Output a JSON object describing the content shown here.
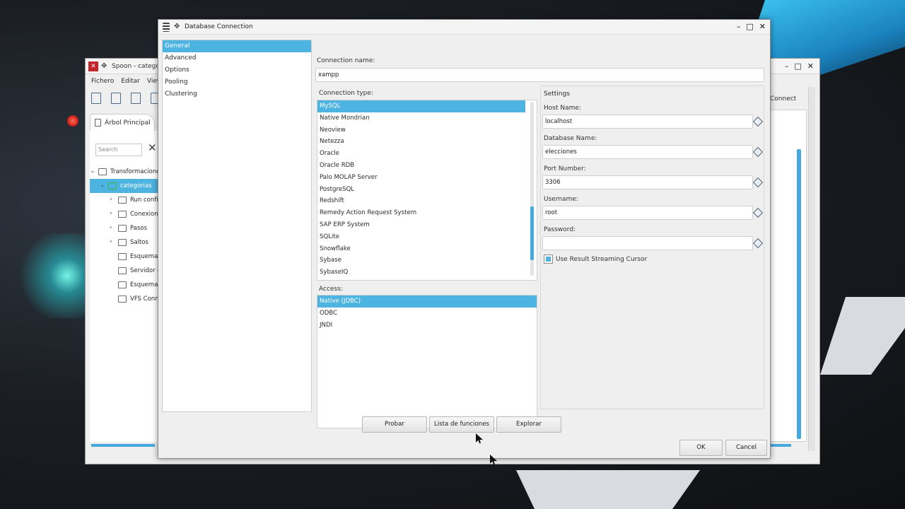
{
  "spoon": {
    "title": "Spoon - categoria",
    "menu": [
      "Fichero",
      "Editar",
      "View"
    ],
    "tab_label": "Árbol Principal",
    "search_placeholder": "Search",
    "tree": [
      {
        "label": "Transformacione",
        "level": 0,
        "expanded": true
      },
      {
        "label": "categorias",
        "level": 1,
        "expanded": true,
        "selected": true
      },
      {
        "label": "Run confi",
        "level": 2,
        "expanded": false
      },
      {
        "label": "Conexion",
        "level": 2,
        "expanded": false
      },
      {
        "label": "Pasos",
        "level": 2,
        "expanded": false
      },
      {
        "label": "Saltos",
        "level": 2,
        "expanded": false
      },
      {
        "label": "Esquema",
        "level": 2,
        "expanded": null
      },
      {
        "label": "Servidor c",
        "level": 2,
        "expanded": null
      },
      {
        "label": "Esquema",
        "level": 2,
        "expanded": null
      },
      {
        "label": "VFS Conn",
        "level": 2,
        "expanded": null
      }
    ],
    "connect_label": "Connect"
  },
  "dialog": {
    "title": "Database Connection",
    "nav": [
      {
        "label": "General",
        "selected": true
      },
      {
        "label": "Advanced",
        "selected": false
      },
      {
        "label": "Options",
        "selected": false
      },
      {
        "label": "Pooling",
        "selected": false
      },
      {
        "label": "Clustering",
        "selected": false
      }
    ],
    "connection_name_label": "Connection name:",
    "connection_name_value": "xampp",
    "connection_type_label": "Connection type:",
    "connection_types": [
      "MySQL",
      "Native Mondrian",
      "Neoview",
      "Netezza",
      "Oracle",
      "Oracle RDB",
      "Palo MOLAP Server",
      "PostgreSQL",
      "Redshift",
      "Remedy Action Request System",
      "SAP ERP System",
      "SQLite",
      "Snowflake",
      "Sybase",
      "SybaseIQ"
    ],
    "connection_type_selected": "MySQL",
    "access_label": "Access:",
    "access_types": [
      "Native (JDBC)",
      "ODBC",
      "JNDI"
    ],
    "access_selected": "Native (JDBC)",
    "settings": {
      "title": "Settings",
      "host_label": "Host Name:",
      "host_value": "localhost",
      "db_label": "Database Name:",
      "db_value": "elecciones",
      "port_label": "Port Number:",
      "port_value": "3306",
      "user_label": "Username:",
      "user_value": "root",
      "password_label": "Password:",
      "password_value": "",
      "streaming_label": "Use Result Streaming Cursor",
      "streaming_checked": true
    },
    "buttons": {
      "test": "Probar",
      "features": "Lista de funciones",
      "explore": "Explorar",
      "ok": "OK",
      "cancel": "Cancel"
    },
    "window_controls": {
      "minimize": "–",
      "maximize": "□",
      "close": "✕"
    }
  },
  "colors": {
    "accent": "#4db3e0",
    "window_bg": "#efefef",
    "field_bg": "#ffffff"
  }
}
